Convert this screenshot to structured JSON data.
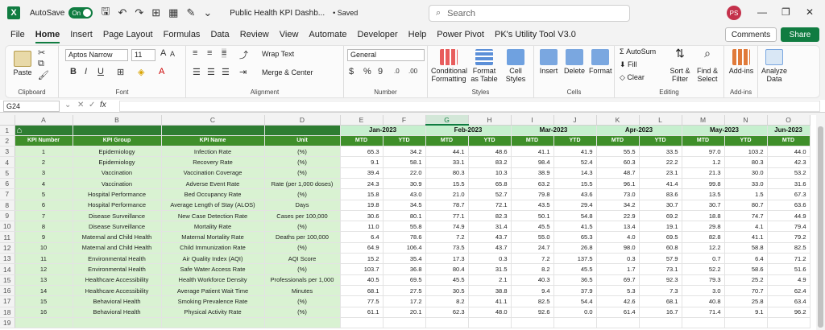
{
  "titlebar": {
    "autosave_label": "AutoSave",
    "autosave_state": "On",
    "doc_title": "Public Health KPI Dashb...",
    "saved_status": "• Saved",
    "search_placeholder": "Search",
    "user_initials": "PS"
  },
  "menu": [
    "File",
    "Home",
    "Insert",
    "Page Layout",
    "Formulas",
    "Data",
    "Review",
    "View",
    "Automate",
    "Developer",
    "Help",
    "Power Pivot",
    "PK's Utility Tool V3.0"
  ],
  "menu_active": "Home",
  "buttons": {
    "comments": "Comments",
    "share": "Share"
  },
  "ribbon": {
    "clipboard": {
      "paste": "Paste",
      "label": "Clipboard"
    },
    "font": {
      "name": "Aptos Narrow",
      "size": "11",
      "label": "Font"
    },
    "alignment": {
      "wrap": "Wrap Text",
      "merge": "Merge & Center",
      "label": "Alignment"
    },
    "number": {
      "format": "General",
      "label": "Number"
    },
    "styles": {
      "conditional": "Conditional Formatting",
      "table": "Format as Table",
      "cell": "Cell Styles",
      "label": "Styles"
    },
    "cells": {
      "insert": "Insert",
      "delete": "Delete",
      "format": "Format",
      "label": "Cells"
    },
    "editing": {
      "autosum": "AutoSum",
      "fill": "Fill",
      "clear": "Clear",
      "sort": "Sort & Filter",
      "find": "Find & Select",
      "label": "Editing"
    },
    "addins": {
      "addins": "Add-ins",
      "label": "Add-ins"
    },
    "analyze": {
      "analyze": "Analyze Data"
    }
  },
  "formula_bar": {
    "name_box": "G24",
    "fx": "fx",
    "formula": ""
  },
  "columns": [
    "A",
    "B",
    "C",
    "D",
    "E",
    "F",
    "G",
    "H",
    "I",
    "J",
    "K",
    "L",
    "M",
    "N",
    "O"
  ],
  "selected_column": "G",
  "months": [
    "Jan-2023",
    "Feb-2023",
    "Mar-2023",
    "Apr-2023",
    "May-2023",
    "Jun-2023"
  ],
  "headers": [
    "KPI Number",
    "KPI Group",
    "KPI Name",
    "Unit"
  ],
  "subheaders": [
    "MTD",
    "YTD"
  ],
  "rows": [
    {
      "n": "1",
      "group": "Epidemiology",
      "name": "Infection Rate",
      "unit": "(%)",
      "v": [
        "65.3",
        "34.2",
        "44.1",
        "48.6",
        "41.1",
        "41.9",
        "55.5",
        "33.5",
        "97.0",
        "103.2",
        "44.0"
      ]
    },
    {
      "n": "2",
      "group": "Epidemiology",
      "name": "Recovery Rate",
      "unit": "(%)",
      "v": [
        "9.1",
        "58.1",
        "33.1",
        "83.2",
        "98.4",
        "52.4",
        "60.3",
        "22.2",
        "1.2",
        "80.3",
        "42.3"
      ]
    },
    {
      "n": "3",
      "group": "Vaccination",
      "name": "Vaccination Coverage",
      "unit": "(%)",
      "v": [
        "39.4",
        "22.0",
        "80.3",
        "10.3",
        "38.9",
        "14.3",
        "48.7",
        "23.1",
        "21.3",
        "30.0",
        "53.2"
      ]
    },
    {
      "n": "4",
      "group": "Vaccination",
      "name": "Adverse Event Rate",
      "unit": "Rate (per 1,000 doses)",
      "v": [
        "24.3",
        "30.9",
        "15.5",
        "65.8",
        "63.2",
        "15.5",
        "96.1",
        "41.4",
        "99.8",
        "33.0",
        "31.6"
      ]
    },
    {
      "n": "5",
      "group": "Hospital Performance",
      "name": "Bed Occupancy Rate",
      "unit": "(%)",
      "v": [
        "15.8",
        "43.0",
        "21.0",
        "52.7",
        "79.8",
        "43.6",
        "73.0",
        "83.6",
        "13.5",
        "1.5",
        "67.3"
      ]
    },
    {
      "n": "6",
      "group": "Hospital Performance",
      "name": "Average Length of Stay (ALOS)",
      "unit": "Days",
      "v": [
        "19.8",
        "34.5",
        "78.7",
        "72.1",
        "43.5",
        "29.4",
        "34.2",
        "30.7",
        "30.7",
        "80.7",
        "63.6"
      ]
    },
    {
      "n": "7",
      "group": "Disease Surveillance",
      "name": "New Case Detection Rate",
      "unit": "Cases per 100,000",
      "v": [
        "30.6",
        "80.1",
        "77.1",
        "82.3",
        "50.1",
        "54.8",
        "22.9",
        "69.2",
        "18.8",
        "74.7",
        "44.9"
      ]
    },
    {
      "n": "8",
      "group": "Disease Surveillance",
      "name": "Mortality Rate",
      "unit": "(%)",
      "v": [
        "11.0",
        "55.8",
        "74.9",
        "31.4",
        "45.5",
        "41.5",
        "13.4",
        "19.1",
        "29.8",
        "4.1",
        "79.4"
      ]
    },
    {
      "n": "9",
      "group": "Maternal and Child Health",
      "name": "Maternal Mortality Rate",
      "unit": "Deaths per 100,000",
      "v": [
        "6.4",
        "78.6",
        "7.2",
        "43.7",
        "55.0",
        "65.3",
        "4.0",
        "69.5",
        "82.8",
        "41.1",
        "79.2"
      ]
    },
    {
      "n": "10",
      "group": "Maternal and Child Health",
      "name": "Child Immunization Rate",
      "unit": "(%)",
      "v": [
        "64.9",
        "106.4",
        "73.5",
        "43.7",
        "24.7",
        "26.8",
        "98.0",
        "60.8",
        "12.2",
        "58.8",
        "82.5"
      ]
    },
    {
      "n": "11",
      "group": "Environmental Health",
      "name": "Air Quality Index (AQI)",
      "unit": "AQI Score",
      "v": [
        "15.2",
        "35.4",
        "17.3",
        "0.3",
        "7.2",
        "137.5",
        "0.3",
        "57.9",
        "0.7",
        "6.4",
        "71.2"
      ]
    },
    {
      "n": "12",
      "group": "Environmental Health",
      "name": "Safe Water Access Rate",
      "unit": "(%)",
      "v": [
        "103.7",
        "36.8",
        "80.4",
        "31.5",
        "8.2",
        "45.5",
        "1.7",
        "73.1",
        "52.2",
        "58.6",
        "51.6"
      ]
    },
    {
      "n": "13",
      "group": "Healthcare Accessibility",
      "name": "Health Workforce Density",
      "unit": "Professionals per 1,000",
      "v": [
        "40.5",
        "69.5",
        "45.5",
        "2.1",
        "40.3",
        "36.5",
        "69.7",
        "92.3",
        "79.3",
        "25.2",
        "4.9"
      ]
    },
    {
      "n": "14",
      "group": "Healthcare Accessibility",
      "name": "Average Patient Wait Time",
      "unit": "Minutes",
      "v": [
        "68.1",
        "27.5",
        "30.5",
        "38.8",
        "9.4",
        "37.9",
        "5.3",
        "7.3",
        "3.0",
        "70.7",
        "62.4"
      ]
    },
    {
      "n": "15",
      "group": "Behavioral Health",
      "name": "Smoking Prevalence Rate",
      "unit": "(%)",
      "v": [
        "77.5",
        "17.2",
        "8.2",
        "41.1",
        "82.5",
        "54.4",
        "42.6",
        "68.1",
        "40.8",
        "25.8",
        "63.4"
      ]
    },
    {
      "n": "16",
      "group": "Behavioral Health",
      "name": "Physical Activity Rate",
      "unit": "(%)",
      "v": [
        "61.1",
        "20.1",
        "62.3",
        "48.0",
        "92.6",
        "0.0",
        "61.4",
        "16.7",
        "71.4",
        "9.1",
        "96.2"
      ]
    }
  ],
  "colors": {
    "excel_green": "#107c41",
    "header_dark": "#2e7d32",
    "header_mid": "#3f8f2a",
    "light_green": "#d9f2d2",
    "month_bg": "#c6efce"
  }
}
